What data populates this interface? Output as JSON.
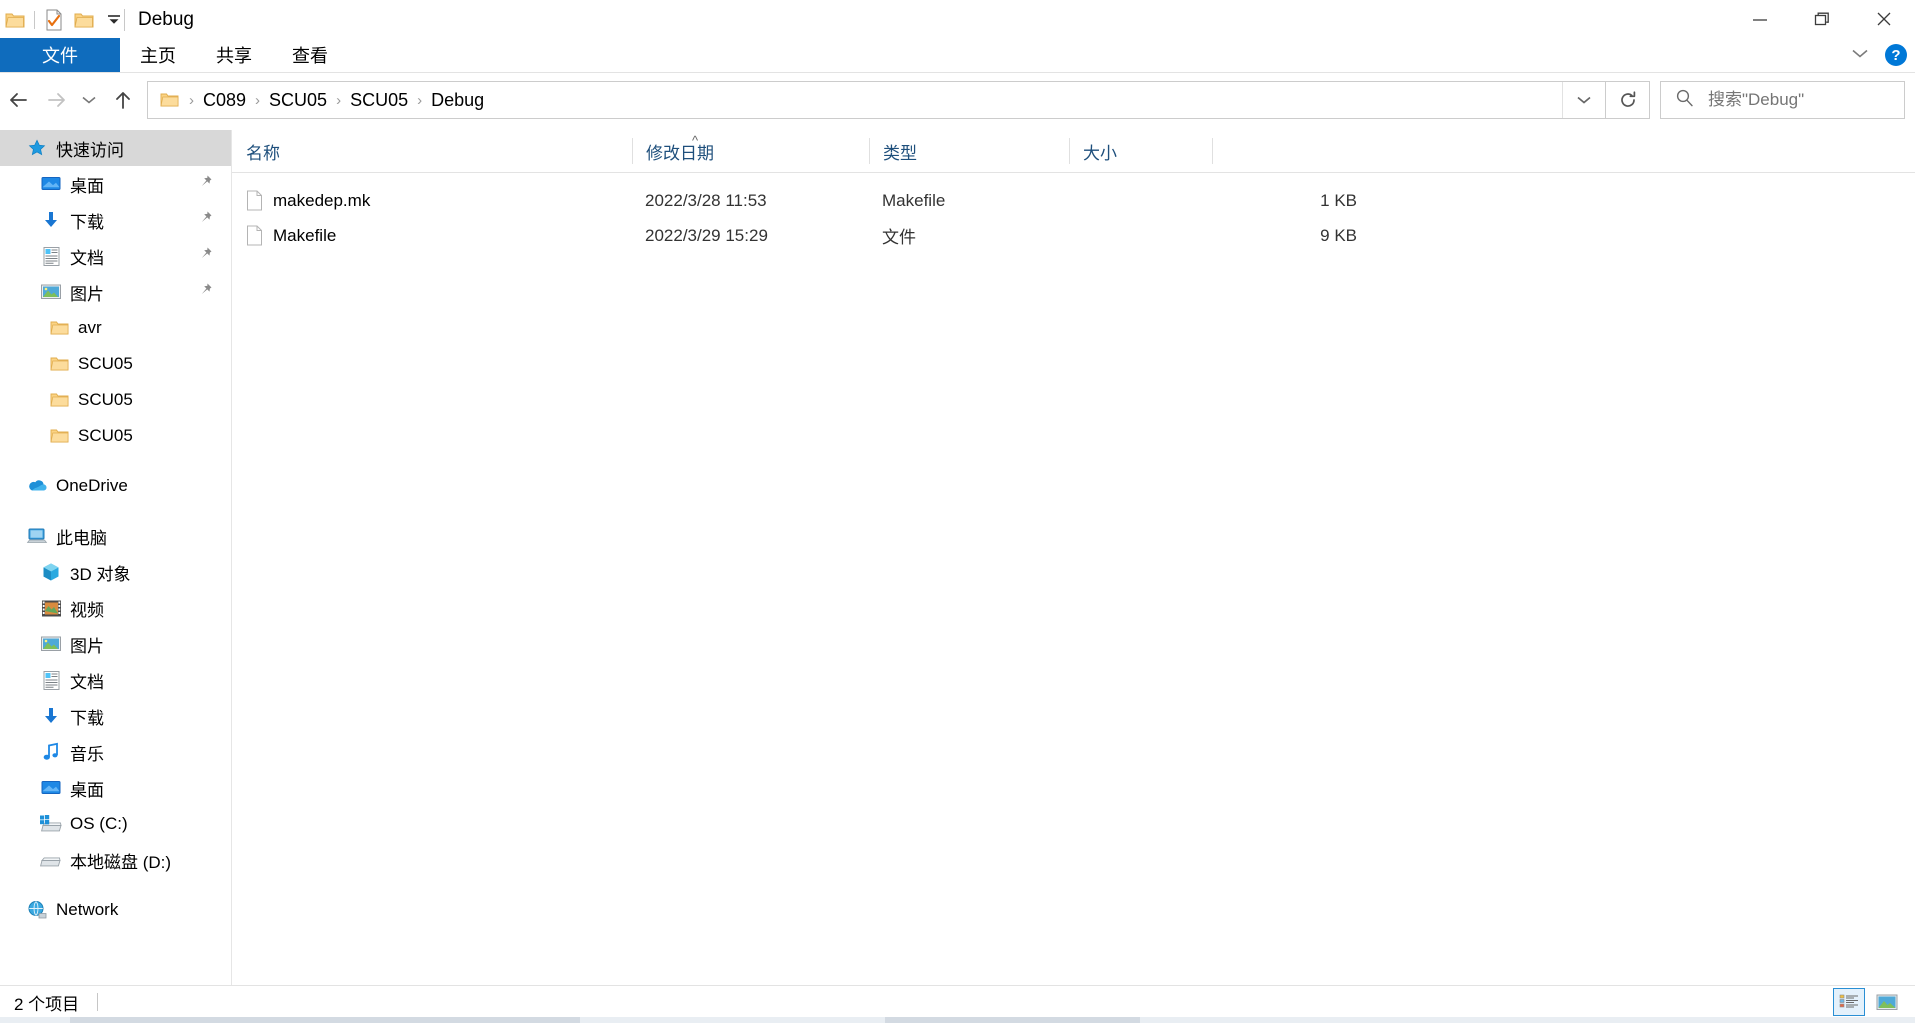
{
  "window": {
    "title": "Debug",
    "quick_access_toolbar": [
      {
        "name": "folder-icon",
        "tooltip": "属性"
      },
      {
        "name": "properties-icon",
        "tooltip": "属性"
      },
      {
        "name": "new-folder-icon",
        "tooltip": "新建文件夹"
      },
      {
        "name": "chevron-down-icon",
        "tooltip": "自定义快速访问工具栏"
      }
    ],
    "controls": {
      "minimize": "最小化",
      "maximize": "最大化",
      "close": "关闭"
    }
  },
  "ribbon": {
    "tabs": [
      {
        "label": "文件",
        "active": true
      },
      {
        "label": "主页",
        "active": false
      },
      {
        "label": "共享",
        "active": false
      },
      {
        "label": "查看",
        "active": false
      }
    ],
    "collapse_label": "展开功能区",
    "help_label": "?"
  },
  "navigation": {
    "back": "后退",
    "forward": "前进",
    "recent": "最近浏览的位置",
    "up": "上移到上一级",
    "breadcrumbs": [
      "C089",
      "SCU05",
      "SCU05",
      "Debug"
    ],
    "separator": "›",
    "history_dropdown": "历史记录",
    "refresh": "刷新"
  },
  "search": {
    "placeholder": "搜索\"Debug\"",
    "value": ""
  },
  "sidebar": {
    "groups": [
      {
        "header": {
          "label": "快速访问",
          "icon": "star-icon",
          "selected": true
        },
        "items": [
          {
            "label": "桌面",
            "icon": "desktop-icon",
            "pinned": true
          },
          {
            "label": "下载",
            "icon": "download-icon",
            "pinned": true
          },
          {
            "label": "文档",
            "icon": "documents-icon",
            "pinned": true
          },
          {
            "label": "图片",
            "icon": "pictures-icon",
            "pinned": true
          },
          {
            "label": "avr",
            "icon": "folder-icon",
            "pinned": false
          },
          {
            "label": "SCU05",
            "icon": "folder-icon",
            "pinned": false
          },
          {
            "label": "SCU05",
            "icon": "folder-icon",
            "pinned": false
          },
          {
            "label": "SCU05",
            "icon": "folder-icon",
            "pinned": false
          }
        ]
      },
      {
        "header": {
          "label": "OneDrive",
          "icon": "onedrive-icon",
          "selected": false
        },
        "items": []
      },
      {
        "header": {
          "label": "此电脑",
          "icon": "this-pc-icon",
          "selected": false
        },
        "items": [
          {
            "label": "3D 对象",
            "icon": "3d-objects-icon",
            "pinned": false
          },
          {
            "label": "视频",
            "icon": "videos-icon",
            "pinned": false
          },
          {
            "label": "图片",
            "icon": "pictures-icon",
            "pinned": false
          },
          {
            "label": "文档",
            "icon": "documents-icon",
            "pinned": false
          },
          {
            "label": "下载",
            "icon": "download-icon",
            "pinned": false
          },
          {
            "label": "音乐",
            "icon": "music-icon",
            "pinned": false
          },
          {
            "label": "桌面",
            "icon": "desktop-icon",
            "pinned": false
          },
          {
            "label": "OS (C:)",
            "icon": "windows-drive-icon",
            "pinned": false
          },
          {
            "label": "本地磁盘 (D:)",
            "icon": "drive-icon",
            "pinned": false
          }
        ]
      },
      {
        "header": {
          "label": "Network",
          "icon": "network-icon",
          "selected": false
        },
        "items": []
      }
    ]
  },
  "file_list": {
    "columns": [
      {
        "label": "名称",
        "sorted": "asc"
      },
      {
        "label": "修改日期",
        "sorted": ""
      },
      {
        "label": "类型",
        "sorted": ""
      },
      {
        "label": "大小",
        "sorted": ""
      }
    ],
    "rows": [
      {
        "name": "makedep.mk",
        "date": "2022/3/28 11:53",
        "type": "Makefile",
        "size": "1 KB",
        "icon": "blank-document-icon"
      },
      {
        "name": "Makefile",
        "date": "2022/3/29 15:29",
        "type": "文件",
        "size": "9 KB",
        "icon": "blank-document-icon"
      }
    ]
  },
  "status": {
    "item_count": "2 个项目",
    "view_details_label": "详细信息",
    "view_large_icons_label": "大图标"
  },
  "colors": {
    "accent": "#0f6cbd",
    "titlebar_accent": "#0078d7",
    "selection": "#d8d8d8",
    "header_text": "#1e4f7c",
    "folder_yellow": "#f7d074",
    "border": "#cccccc"
  }
}
